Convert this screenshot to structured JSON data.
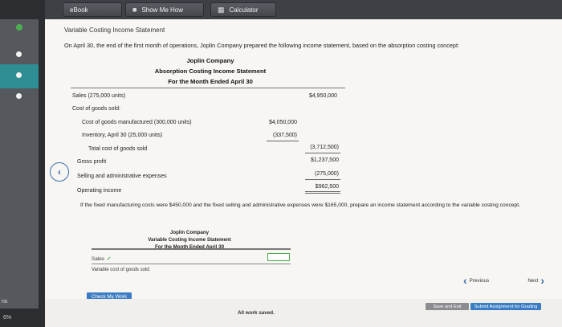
{
  "toolbar": {
    "ebook": "eBook",
    "show_me_how": "Show Me How",
    "calculator": "Calculator"
  },
  "rail": {
    "label_ns": "ns",
    "label_pct": "6%"
  },
  "section_title": "Variable Costing Income Statement",
  "intro": "On April 30, the end of the first month of operations, Joplin Company prepared the following income statement, based on the absorption costing concept:",
  "statement": {
    "company": "Joplin Company",
    "title": "Absorption Costing Income Statement",
    "period": "For the Month Ended April 30",
    "rows": {
      "sales_label": "Sales (275,000 units)",
      "sales_value": "$4,950,000",
      "cogs_label": "Cost of goods sold:",
      "cgm_label": "Cost of goods manufactured (300,000 units)",
      "cgm_value": "$4,050,000",
      "inv_label": "Inventory, April 30 (25,000 units)",
      "inv_value": "(337,500)",
      "total_cogs_label": "Total cost of goods sold",
      "total_cogs_value": "(3,712,500)",
      "gross_profit_label": "Gross profit",
      "gross_profit_value": "$1,237,500",
      "selling_label": "Selling and administrative expenses",
      "selling_value": "(275,000)",
      "operating_label": "Operating income",
      "operating_value": "$962,500"
    }
  },
  "question": "If the fixed manufacturing costs were $450,000 and the fixed selling and administrative expenses were $165,000, prepare an income statement according to the variable costing concept.",
  "answer_statement": {
    "company": "Joplin Company",
    "title": "Variable Costing Income Statement",
    "period": "For the Month Ended April 30",
    "sales_label": "Sales",
    "variable_cost_label": "Variable cost of goods sold:"
  },
  "buttons": {
    "check_my_work": "Check My Work",
    "previous": "Previous",
    "next": "Next",
    "save_exit": "Save and Exit",
    "submit": "Submit Assignment for Grading"
  },
  "status": {
    "saved": "All work saved."
  }
}
